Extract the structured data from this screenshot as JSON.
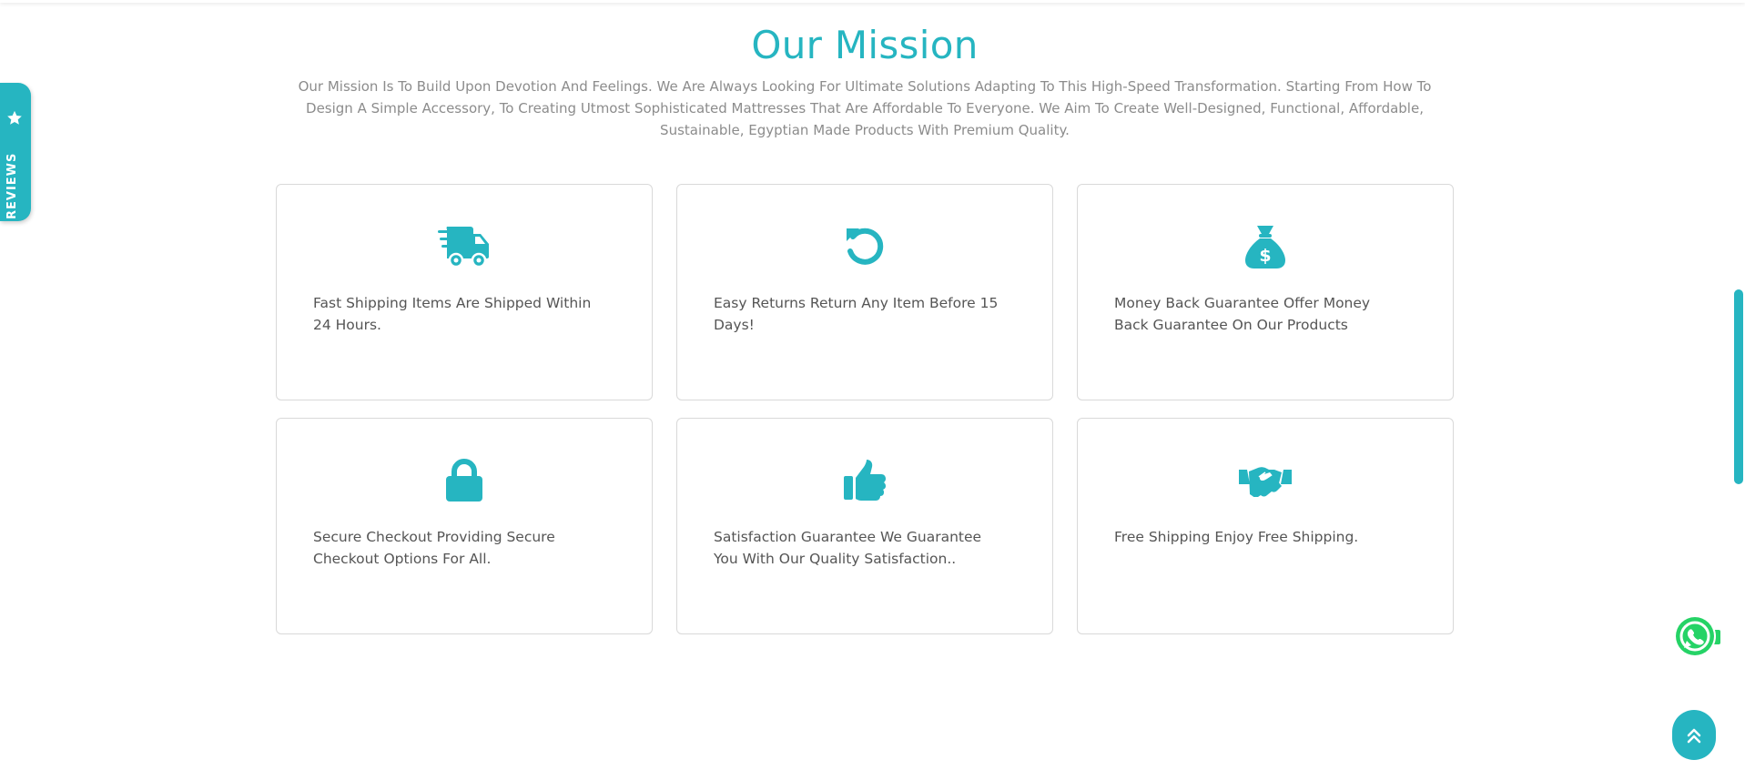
{
  "mission": {
    "title": "Our Mission",
    "description": "Our Mission Is To Build Upon Devotion And Feelings. We Are Always Looking For Ultimate Solutions Adapting To This High-Speed Transformation. Starting From How To Design A Simple Accessory, To Creating Utmost Sophisticated Mattresses That Are Affordable To Everyone. We Aim To Create Well-Designed, Functional, Affordable, Sustainable, Egyptian Made Products With Premium Quality."
  },
  "features": [
    {
      "icon": "truck-icon",
      "text": "Fast Shipping Items Are Shipped Within 24 Hours."
    },
    {
      "icon": "return-arrow-icon",
      "text": "Easy Returns Return Any Item Before 15 Days!"
    },
    {
      "icon": "money-bag-icon",
      "text": "Money Back Guarantee Offer Money Back Guarantee On Our Products"
    },
    {
      "icon": "lock-icon",
      "text": "Secure Checkout Providing Secure Checkout Options For All."
    },
    {
      "icon": "thumbs-up-icon",
      "text": "Satisfaction Guarantee We Guarantee You With Our Quality Satisfaction.."
    },
    {
      "icon": "handshake-icon",
      "text": "Free Shipping Enjoy Free Shipping."
    }
  ],
  "reviews_tab": {
    "label": "REVIEWS"
  },
  "colors": {
    "accent": "#26b5c1",
    "whatsapp": "#25d366",
    "text": "#555555"
  }
}
